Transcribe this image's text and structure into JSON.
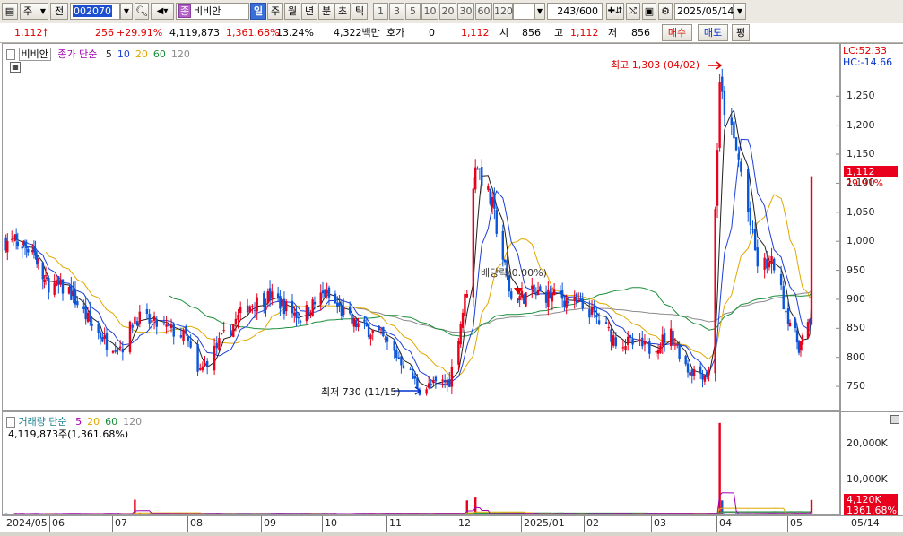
{
  "toolbar": {
    "type_label": "주",
    "prev_label": "전",
    "code": "002070",
    "stock_icon_label": "종",
    "stock_name": "비비안",
    "periods": [
      "일",
      "주",
      "월",
      "년",
      "분",
      "초",
      "틱"
    ],
    "selected_period": "일",
    "intervals": [
      "1",
      "3",
      "5",
      "10",
      "20",
      "30",
      "60",
      "120"
    ],
    "count": "243/600",
    "date": "2025/05/14"
  },
  "info": {
    "price": "1,112",
    "change": "256",
    "change_pct": "+29.91%",
    "volume": "4,119,873",
    "volume_ratio": "1,361.68%",
    "turnover": "13.24%",
    "amount": "4,322백만",
    "quote_label": "호가",
    "quote_value": "0",
    "quote_price": "1,112",
    "open_label": "시",
    "open": "856",
    "high_label": "고",
    "high": "1,112",
    "low_label": "저",
    "low": "856",
    "buy_label": "매수",
    "sell_label": "매도",
    "avg_label": "평"
  },
  "price_pane": {
    "name_tag": "비비안",
    "legend_title": "종가 단순",
    "ma_periods": [
      "5",
      "10",
      "20",
      "60",
      "120"
    ],
    "ma_colors": [
      "#202020",
      "#1f3fd8",
      "#e0a800",
      "#1a8f3a",
      "#8a8a8a"
    ],
    "high_annotation": "최고 1,303 (04/02)",
    "low_annotation": "최저 730 (11/15)",
    "dividend_annotation": "배당락(0.00%)",
    "lc": "LC:52.33",
    "hc": "HC:-14.66",
    "current_price_badge": "1,112",
    "current_pct_badge": "29.91%",
    "up_color": "#e8001c",
    "down_color": "#0b55d8"
  },
  "volume_pane": {
    "title": "거래량 단순",
    "ma_periods": [
      "5",
      "20",
      "60",
      "120"
    ],
    "ma_colors": [
      "#a000b0",
      "#e0a800",
      "#1a8f3a",
      "#8a8a8a"
    ],
    "current_text": "4,119,873주(1,361.68%)",
    "badge_volume": "4,120K",
    "badge_pct": "1361.68%"
  },
  "chart_data": {
    "type": "candlestick",
    "price_axis": {
      "ticks": [
        "1,250",
        "1,200",
        "1,150",
        "1,100",
        "1,050",
        "1,000",
        "950",
        "900",
        "850",
        "800",
        "750"
      ],
      "ylim": [
        710,
        1340
      ]
    },
    "volume_axis": {
      "ticks": [
        "20,000K",
        "10,000K"
      ],
      "ylim": [
        0,
        29000
      ]
    },
    "date_ticks": [
      "2024/05",
      "06",
      "07",
      "08",
      "09",
      "10",
      "11",
      "12",
      "2025/01",
      "02",
      "03",
      "04",
      "05",
      "05/14"
    ],
    "close_path": [
      {
        "d": "2024-05-02",
        "c": 1000
      },
      {
        "d": "2024-05-20",
        "c": 990
      },
      {
        "d": "2024-05-28",
        "c": 930
      },
      {
        "d": "2024-06-10",
        "c": 915
      },
      {
        "d": "2024-06-20",
        "c": 860
      },
      {
        "d": "2024-06-28",
        "c": 825
      },
      {
        "d": "2024-07-05",
        "c": 820
      },
      {
        "d": "2024-07-10",
        "c": 870
      },
      {
        "d": "2024-07-20",
        "c": 855
      },
      {
        "d": "2024-07-31",
        "c": 835
      },
      {
        "d": "2024-08-05",
        "c": 770
      },
      {
        "d": "2024-08-15",
        "c": 830
      },
      {
        "d": "2024-08-26",
        "c": 890
      },
      {
        "d": "2024-09-05",
        "c": 905
      },
      {
        "d": "2024-09-20",
        "c": 870
      },
      {
        "d": "2024-10-02",
        "c": 910
      },
      {
        "d": "2024-10-15",
        "c": 860
      },
      {
        "d": "2024-10-28",
        "c": 840
      },
      {
        "d": "2024-11-08",
        "c": 790
      },
      {
        "d": "2024-11-15",
        "c": 745
      },
      {
        "d": "2024-11-28",
        "c": 760
      },
      {
        "d": "2024-12-06",
        "c": 920
      },
      {
        "d": "2024-12-10",
        "c": 1140
      },
      {
        "d": "2024-12-18",
        "c": 1060
      },
      {
        "d": "2024-12-27",
        "c": 900
      },
      {
        "d": "2025-01-06",
        "c": 910
      },
      {
        "d": "2025-01-20",
        "c": 905
      },
      {
        "d": "2025-02-03",
        "c": 880
      },
      {
        "d": "2025-02-14",
        "c": 830
      },
      {
        "d": "2025-02-28",
        "c": 815
      },
      {
        "d": "2025-03-10",
        "c": 840
      },
      {
        "d": "2025-03-18",
        "c": 780
      },
      {
        "d": "2025-03-28",
        "c": 770
      },
      {
        "d": "2025-04-02",
        "c": 1260
      },
      {
        "d": "2025-04-10",
        "c": 1140
      },
      {
        "d": "2025-04-18",
        "c": 960
      },
      {
        "d": "2025-04-25",
        "c": 960
      },
      {
        "d": "2025-04-30",
        "c": 880
      },
      {
        "d": "2025-05-07",
        "c": 820
      },
      {
        "d": "2025-05-13",
        "c": 856
      },
      {
        "d": "2025-05-14",
        "c": 1112
      }
    ],
    "volume_spikes": [
      {
        "d": "2024-07-10",
        "v": 4200
      },
      {
        "d": "2024-12-06",
        "v": 4000
      },
      {
        "d": "2024-12-10",
        "v": 4800
      },
      {
        "d": "2025-04-02",
        "v": 26000
      },
      {
        "d": "2025-04-03",
        "v": 4000
      },
      {
        "d": "2025-05-14",
        "v": 4120
      }
    ]
  }
}
